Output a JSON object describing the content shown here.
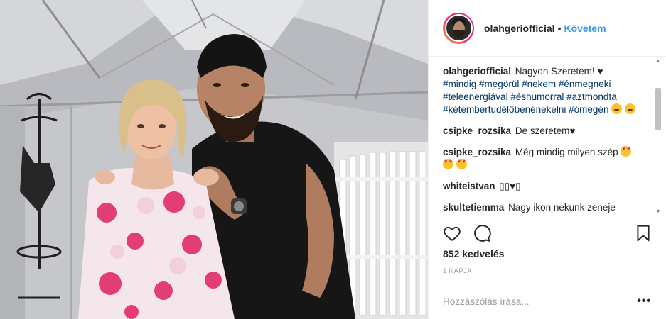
{
  "post": {
    "username": "olahgeriofficial",
    "separator": "•",
    "follow_label": "Követem",
    "comments": [
      {
        "user": "olahgeriofficial",
        "text": "Nagyon Szeretem! ♥",
        "hashtags": [
          "#mindig",
          "#megörül",
          "#nekem",
          "#énmegneki",
          "#teleenergiával",
          "#éshumorral",
          "#aztmondta",
          "#kétembertudélőbenénekelni",
          "#ómegén"
        ]
      },
      {
        "user": "csipke_rozsika",
        "text": "De szeretem♥"
      },
      {
        "user": "csipke_rozsika",
        "text": "Még mindig milyen szép"
      },
      {
        "user": "whiteistvan",
        "text": "▯▯♥▯"
      },
      {
        "user": "skultetiemma",
        "text": "Nagy ikon nekunk zeneje anno sokat jartam tancdal fesztivalra"
      }
    ],
    "likes": "852 kedvelés",
    "time_ago": "1 NAPJA",
    "comment_placeholder": "Hozzászólás írása...",
    "more_options": "•••"
  },
  "icons": {
    "like": "heart-outline-icon",
    "comment": "speech-bubble-icon",
    "save": "bookmark-icon",
    "more": "more-options-icon"
  },
  "colors": {
    "link": "#3897f0",
    "hashtag": "#003569",
    "text": "#262626",
    "muted": "#999999",
    "border": "#efefef"
  }
}
